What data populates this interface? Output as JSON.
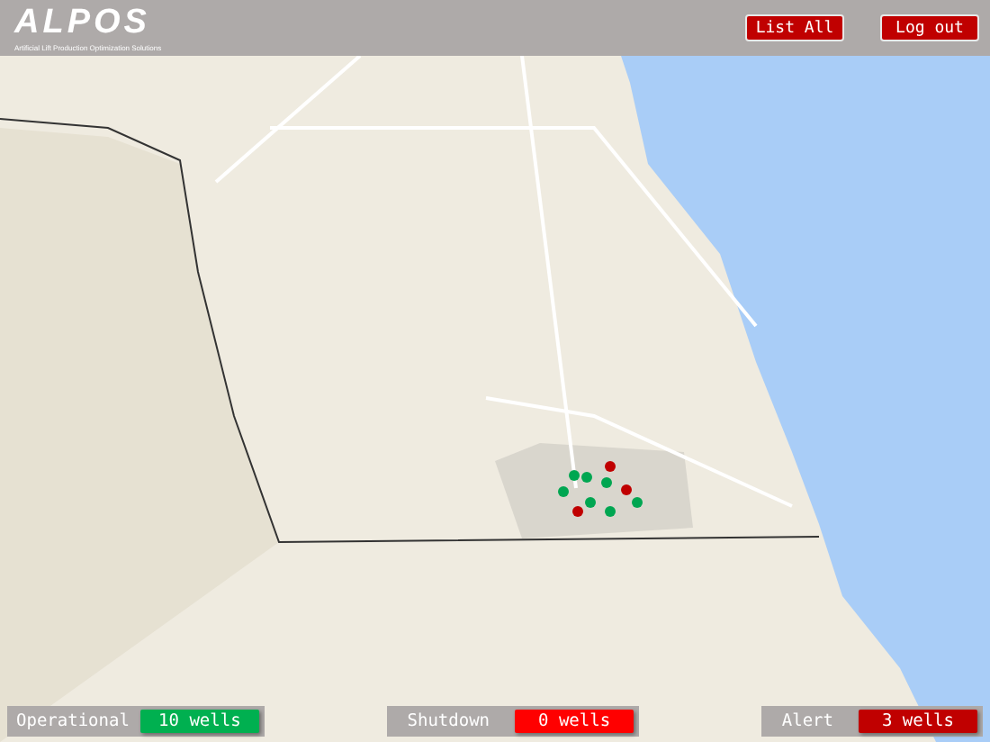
{
  "header": {
    "logo": "ALPOS",
    "tagline": "Artificial Lift Production Optimization Solutions",
    "buttons": [
      "List All",
      "Log out"
    ]
  },
  "map": {
    "wells": [
      {
        "color": "#00a651"
      },
      {
        "color": "#00a651"
      },
      {
        "color": "#00a651"
      },
      {
        "color": "#00a651"
      },
      {
        "color": "#00a651"
      },
      {
        "color": "#00a651"
      },
      {
        "color": "#00a651"
      },
      {
        "color": "#c00000"
      },
      {
        "color": "#c00000"
      },
      {
        "color": "#c00000"
      }
    ]
  },
  "status_bar": [
    {
      "kind": "operational",
      "label": "Operational",
      "count": "10 wells"
    },
    {
      "kind": "shutdown",
      "label": "Shutdown",
      "count": "0 wells"
    },
    {
      "kind": "alert",
      "label": "Alert",
      "count": "3 wells"
    }
  ]
}
